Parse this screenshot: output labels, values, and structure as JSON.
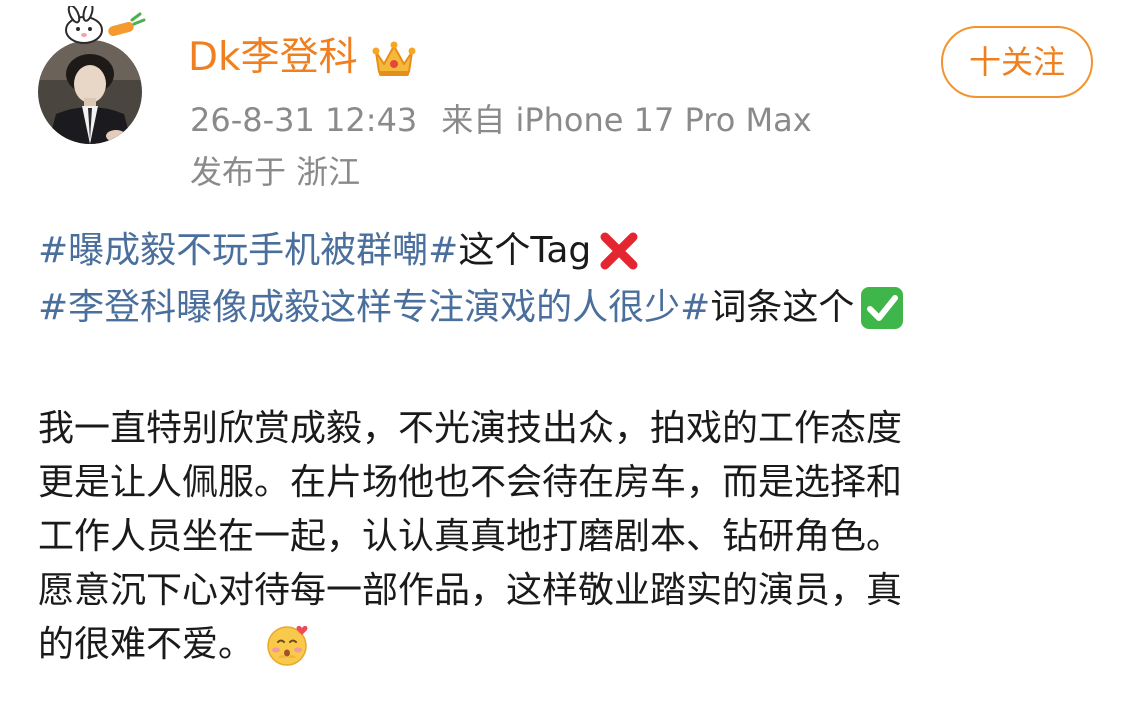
{
  "author": {
    "name": "Dk李登科",
    "badge_icon": "crown-icon",
    "avatar_decoration_icon": "bunny-carrot-icon"
  },
  "post_meta": {
    "timestamp": "26-8-31 12:43",
    "source": "来自 iPhone 17 Pro Max",
    "location": "发布于 浙江"
  },
  "follow_button": {
    "label": "十关注"
  },
  "content": {
    "tag_line_1": {
      "hashtag": "#曝成毅不玩手机被群嘲#",
      "text": " 这个Tag",
      "icon": "cross-mark-icon"
    },
    "tag_line_2": {
      "hashtag": "#李登科曝像成毅这样专注演戏的人很少#",
      "text": "词条这个",
      "icon": "check-mark-icon"
    },
    "paragraph_lines": [
      "我一直特别欣赏成毅，不光演技出众，拍戏的工作态度",
      "更是让人佩服。在片场他也不会待在房车，而是选择和",
      "工作人员坐在一起，认认真真地打磨剧本、钻研角色。",
      "愿意沉下心对待每一部作品，这样敬业踏实的演员，真",
      "的很难不爱。"
    ],
    "end_icon": "blush-hearts-icon"
  },
  "colors": {
    "username": "#f07f1f",
    "hashtag": "#4a6f9c",
    "meta": "#8a8a8a",
    "follow_border": "#f3932f",
    "text": "#1a1a1a"
  }
}
